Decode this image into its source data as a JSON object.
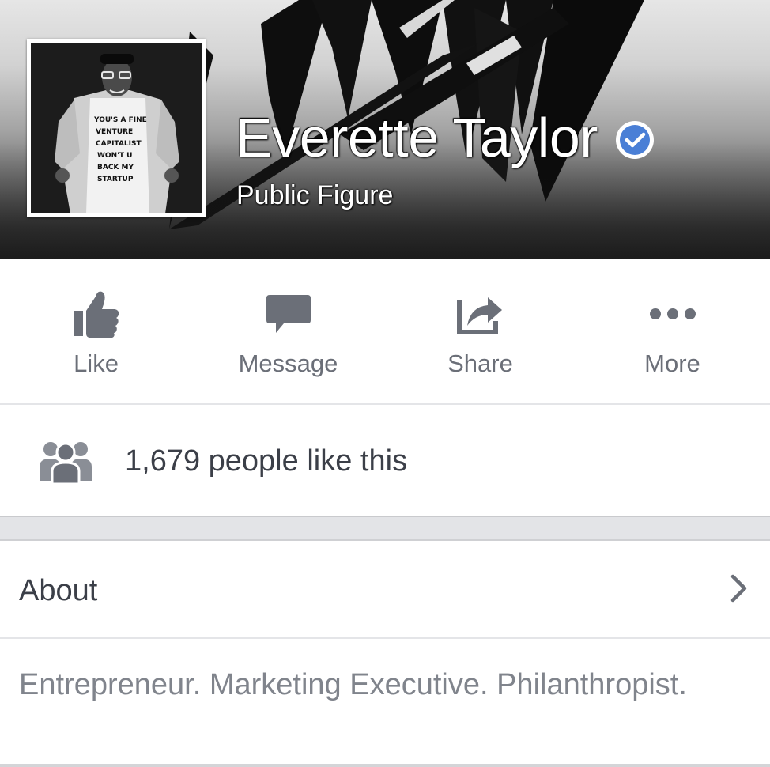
{
  "profile": {
    "name": "Everette Taylor",
    "category": "Public Figure",
    "verified": true,
    "shirt_text": [
      "YOU'S A FINE",
      "VENTURE",
      "CAPITALIST",
      "WON'T U",
      "BACK MY",
      "STARTUP"
    ]
  },
  "actions": [
    {
      "label": "Like",
      "icon": "thumbs-up-icon"
    },
    {
      "label": "Message",
      "icon": "speech-bubble-icon"
    },
    {
      "label": "Share",
      "icon": "share-arrow-icon"
    },
    {
      "label": "More",
      "icon": "ellipsis-icon"
    }
  ],
  "likes": {
    "text": "1,679 people like this",
    "icon": "people-icon"
  },
  "about": {
    "title": "About",
    "description": "Entrepreneur. Marketing Executive. Philanthropist."
  },
  "colors": {
    "icon_gray": "#6b6f78",
    "text_dark": "#3b3f48",
    "text_muted": "#80848c",
    "verified_blue": "#4a7fd6",
    "divider": "#e4e5e8"
  }
}
